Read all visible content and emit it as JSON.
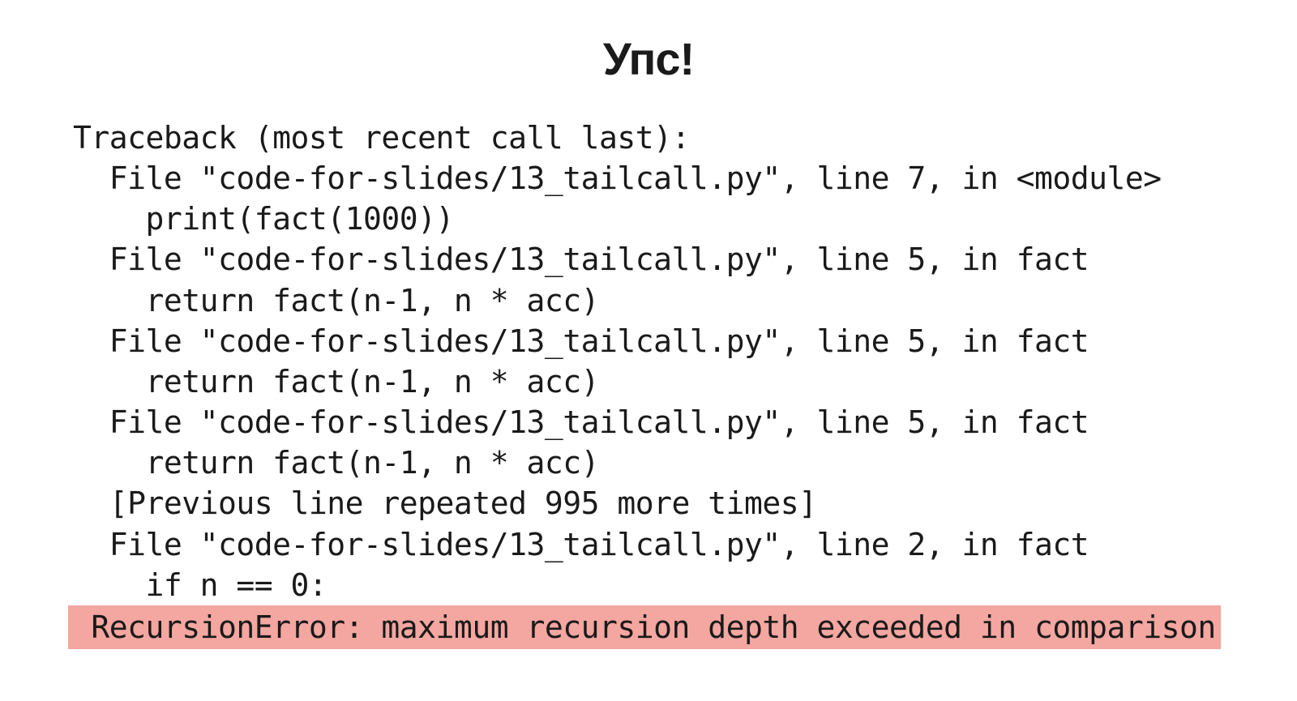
{
  "slide": {
    "title": "Упс!",
    "traceback": {
      "header": "Traceback (most recent call last):",
      "frames": [
        {
          "location": "  File \"code-for-slides/13_tailcall.py\", line 7, in <module>",
          "code": "    print(fact(1000))"
        },
        {
          "location": "  File \"code-for-slides/13_tailcall.py\", line 5, in fact",
          "code": "    return fact(n-1, n * acc)"
        },
        {
          "location": "  File \"code-for-slides/13_tailcall.py\", line 5, in fact",
          "code": "    return fact(n-1, n * acc)"
        },
        {
          "location": "  File \"code-for-slides/13_tailcall.py\", line 5, in fact",
          "code": "    return fact(n-1, n * acc)"
        }
      ],
      "repeat_note": "  [Previous line repeated 995 more times]",
      "last_frame": {
        "location": "  File \"code-for-slides/13_tailcall.py\", line 2, in fact",
        "code": "    if n == 0:"
      },
      "error": " RecursionError: maximum recursion depth exceeded in comparison"
    }
  }
}
